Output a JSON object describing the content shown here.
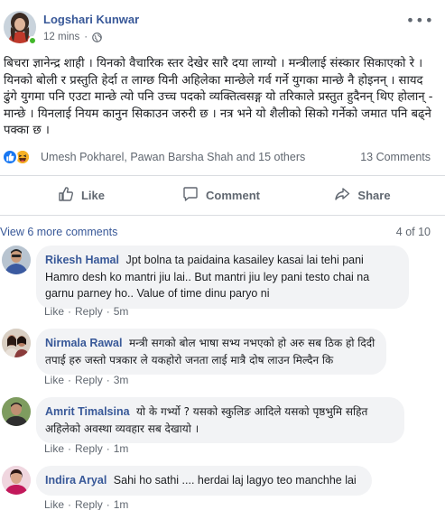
{
  "post": {
    "author": "Logshari Kunwar",
    "time": "12 mins",
    "dot": "·",
    "text": "बिचरा ज्ञानेन्द्र शाही । यिनको वैचारिक स्तर देखेर सारै दया लाग्यो । मन्त्रीलाई संस्कार सिकाएको रे । यिनको बोली र प्रस्तुति हेर्दा त लाग्छ यिनी अहिलेका मान्छेले गर्व गर्ने युगका मान्छे नै होइनन् । सायद ढुंगे युगमा पनि एउटा मान्छे त्यो पनि उच्च पदको व्यक्तित्वसङ्ग यो तरिकाले प्रस्तुत हुदैनन् थिए होलान् - मान्छे । यिनलाई नियम कानुन सिकाउन जरुरी छ । नत्र भने यो शैलीको सिको गर्नेको जमात पनि बढ्ने पक्का छ ।"
  },
  "reactions": {
    "names": "Umesh Pokharel, Pawan Barsha Shah and 15 others",
    "comments_count": "13 Comments",
    "like_color": "#1877f2",
    "haha_color": "#f7b125"
  },
  "actions": {
    "like": "Like",
    "comment": "Comment",
    "share": "Share"
  },
  "comments_header": {
    "view_more": "View 6 more comments",
    "page": "4 of 10"
  },
  "comments": [
    {
      "name": "Rikesh Hamal",
      "text": "Jpt bolna ta paidaina kasailey kasai lai tehi pani Hamro desh ko mantri jiu lai.. But mantri jiu ley pani testo chai na garnu parney ho.. Value of time dinu paryo ni",
      "like": "Like",
      "reply": "Reply",
      "time": "5m"
    },
    {
      "name": "Nirmala Rawal",
      "text": "मन्त्री सगको बोल भाषा सभ्य नभएको हो अरु सब ठिक हो दिदी तपाई हरु जस्तो पत्रकार ले यकहोरो जनता लाई मात्रै दोष लाउन मिल्दैन कि",
      "like": "Like",
      "reply": "Reply",
      "time": "3m"
    },
    {
      "name": "Amrit Timalsina",
      "text": "यो के गर्भ्यो ? यसको स्कुलिङ आदिले यसको पृष्ठभुमि सहित अहिलेको अवस्था व्यवहार सब देखायो ।",
      "like": "Like",
      "reply": "Reply",
      "time": "1m"
    },
    {
      "name": "Indira Aryal",
      "text": "Sahi ho sathi .... herdai laj lagyo teo manchhe lai",
      "like": "Like",
      "reply": "Reply",
      "time": "1m"
    }
  ],
  "colors": {
    "link_blue": "#385898",
    "meta_grey": "#606770",
    "bubble_bg": "#f2f3f5",
    "online_green": "#42b72a"
  },
  "icons": [
    "globe-icon",
    "options-icon",
    "like-reaction-icon",
    "haha-reaction-icon",
    "thumbs-up-icon",
    "comment-icon",
    "share-icon"
  ]
}
